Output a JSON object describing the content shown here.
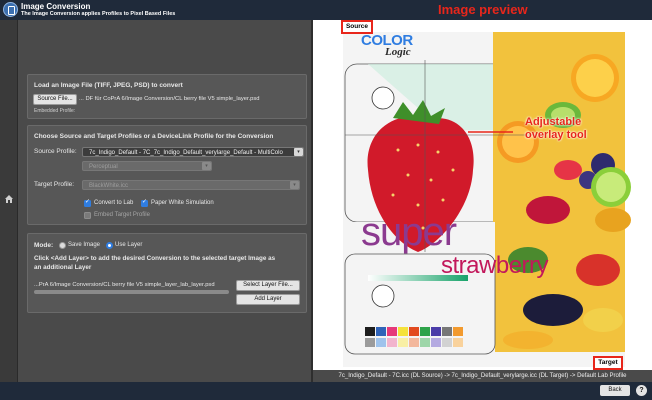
{
  "header": {
    "title": "Image Conversion",
    "subtitle": "The Image Conversion applies Profiles to Pixel Based Files",
    "preview_heading": "Image preview"
  },
  "load_panel": {
    "heading": "Load an Image File (TIFF, JPEG, PSD) to convert",
    "source_button": "Source File...",
    "source_path": "... DF für CoPrA 6/Image Conversion/CL berry file V5 simple_layer.psd",
    "embedded_profile_label": "Embedded Profile:",
    "embedded_profile_value": ""
  },
  "profile_panel": {
    "heading": "Choose Source and Target Profiles or a DeviceLink Profile for the Conversion",
    "source_profile_label": "Source Profile:",
    "source_profile_value": "7c_Indigo_Default - 7C_7c_Indigo_Default_verylarge_Default - MultiColo",
    "rendering_intent_value": "Perceptual",
    "target_profile_label": "Target Profile:",
    "target_profile_value": "BlackWhite.icc",
    "convert_to_lab_label": "Convert to Lab",
    "convert_to_lab_checked": true,
    "paper_white_label": "Paper White Simulation",
    "paper_white_checked": true,
    "embed_target_label": "Embed Target Profile",
    "embed_target_checked": false
  },
  "mode_panel": {
    "mode_label": "Mode:",
    "save_image_label": "Save Image",
    "use_layer_label": "Use Layer",
    "selected_mode": "Use Layer",
    "instruction_line1": "Click <Add Layer> to add the desired Conversion to the selected target Image as",
    "instruction_line2": "an additional Layer",
    "layer_path": "...PrA 6/Image Conversion/CL berry file V5 simple_layer_lab_layer.psd",
    "select_layer_button": "Select Layer File...",
    "add_layer_button": "Add Layer"
  },
  "preview": {
    "source_label": "Source",
    "target_label": "Target",
    "overlay_annotation_line1": "Adjustable",
    "overlay_annotation_line2": "overlay tool",
    "brand_color": "COLOR",
    "brand_logic": "Logic",
    "headline_word1": "super",
    "headline_word2": "strawberry",
    "caption": "7c_Indigo_Default - 7C.icc (DL Source) -> 7c_Indigo_Default_verylarge.icc (DL Target) -> Default Lab Profile"
  },
  "footer": {
    "back_button": "Back",
    "help_button": "?"
  },
  "colors": {
    "accent_red": "#e8261b",
    "header_bg": "#1f2a3a",
    "panel_bg": "#575757",
    "checkbox_blue": "#2f7de1",
    "headline_purple": "#8b3a8f",
    "headline_magenta": "#c2185b"
  }
}
